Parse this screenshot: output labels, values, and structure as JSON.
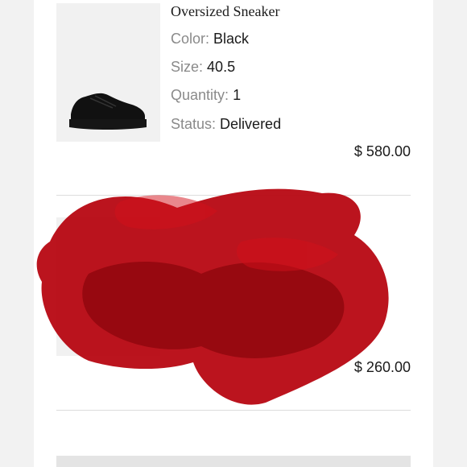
{
  "items": [
    {
      "name": "Oversized Sneaker",
      "color_label": "Color:",
      "color_value": "Black",
      "size_label": "Size:",
      "size_value": "40.5",
      "quantity_label": "Quantity:",
      "quantity_value": "1",
      "status_label": "Status:",
      "status_value": "Delivered",
      "price": "$ 580.00"
    },
    {
      "price": "$ 260.00"
    }
  ],
  "colors": {
    "scribble": "#b5000b",
    "panel": "#ffffff",
    "thumb_bg": "#f1f1f1"
  }
}
